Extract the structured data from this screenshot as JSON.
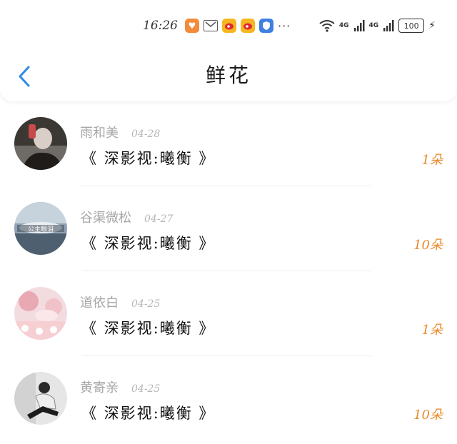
{
  "status": {
    "time": "16:26",
    "icons": [
      "app-icon-heart",
      "mail-icon",
      "weibo-icon",
      "weibo-icon",
      "shield-app-icon"
    ],
    "more": "···",
    "network1": "4G",
    "network2": "4G",
    "battery": "100"
  },
  "header": {
    "title": "鲜花",
    "back_icon": "chevron-left-icon",
    "accent": "#2f8ae5"
  },
  "records": [
    {
      "name": "雨和美",
      "date": "04-28",
      "gift": "《 深影视:曦衡 》",
      "count": "1朵"
    },
    {
      "name": "谷渠微松",
      "date": "04-27",
      "gift": "《 深影视:曦衡 》",
      "count": "10朵"
    },
    {
      "name": "道依白",
      "date": "04-25",
      "gift": "《 深影视:曦衡 》",
      "count": "1朵"
    },
    {
      "name": "黄寄亲",
      "date": "04-25",
      "gift": "《 深影视:曦衡 》",
      "count": "10朵"
    }
  ],
  "colors": {
    "count": "#ea8a2a",
    "name": "#a7a7a7",
    "date": "#b6b6b6"
  }
}
